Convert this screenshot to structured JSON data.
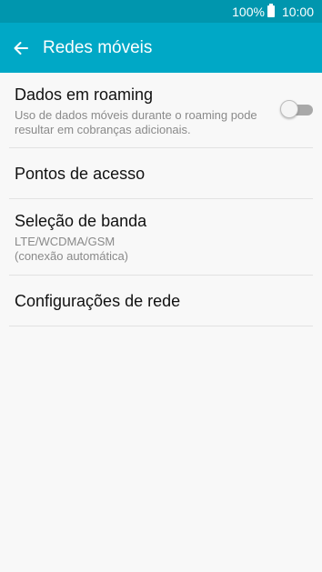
{
  "status_bar": {
    "battery_percent": "100%",
    "time": "10:00"
  },
  "app_bar": {
    "title": "Redes móveis",
    "back_icon": "arrow-left-icon"
  },
  "settings": {
    "roaming": {
      "title": "Dados em roaming",
      "subtitle": "Uso de dados móveis durante o roaming pode resultar em cobranças adicionais.",
      "toggle_state": "off"
    },
    "apn": {
      "title": "Pontos de acesso"
    },
    "band": {
      "title": "Seleção de banda",
      "value_line1": "LTE/WCDMA/GSM",
      "value_line2": "(conexão automática)"
    },
    "network_config": {
      "title": "Configurações de rede"
    }
  },
  "colors": {
    "status_bar": "#0096ae",
    "app_bar": "#00a8c6",
    "background": "#f8f8f8"
  }
}
